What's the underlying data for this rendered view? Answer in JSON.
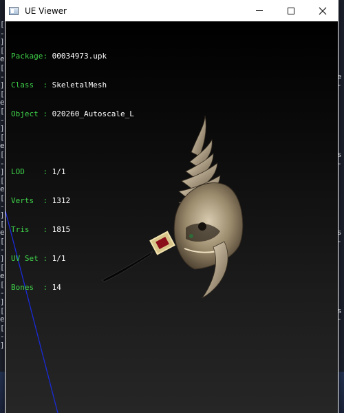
{
  "window": {
    "title": "UE Viewer",
    "controls": {
      "minimize": "minimize",
      "maximize": "maximize",
      "close": "close"
    }
  },
  "info": {
    "package": {
      "label": "Package:",
      "value": "00034973.upk"
    },
    "class": {
      "label": "Class  :",
      "value": "SkeletalMesh"
    },
    "object": {
      "label": "Object :",
      "value": "020260_Autoscale_L"
    },
    "lod": {
      "label": "LOD    :",
      "value": "1/1"
    },
    "verts": {
      "label": "Verts  :",
      "value": "1312"
    },
    "tris": {
      "label": "Tris   :",
      "value": "1815"
    },
    "uvset": {
      "label": "UV Set :",
      "value": "1/1"
    },
    "bones": {
      "label": "Bones  :",
      "value": "14"
    }
  },
  "background": {
    "left_strip": "[\n-\n]\n[\ne\n[\n-\n]\n[\ne\n[\n-\n]\n[\ne\n[\n-\n]\n[\ne\n[\n-\n]\n[\ne\n[\n-\n]\n[\ne\n[\n-\n]\n[\ne\n[\n-\n]",
    "right_strip": "\n\n\n\n\n\ne\n-\n\n\n\n\n\n\n\ns\n-\n\n\n\n\n\n\n\ns\n-\n\n\n\n\n\n\n\ns\n-\n\n\n\n\n\n\n\ns\n-"
  },
  "colors": {
    "label_green": "#3fd34a",
    "value_white": "#ffffff",
    "axis_blue": "#1a2bd8",
    "mesh_bone": "#b7a585",
    "gem_red": "#8b0f1a"
  }
}
